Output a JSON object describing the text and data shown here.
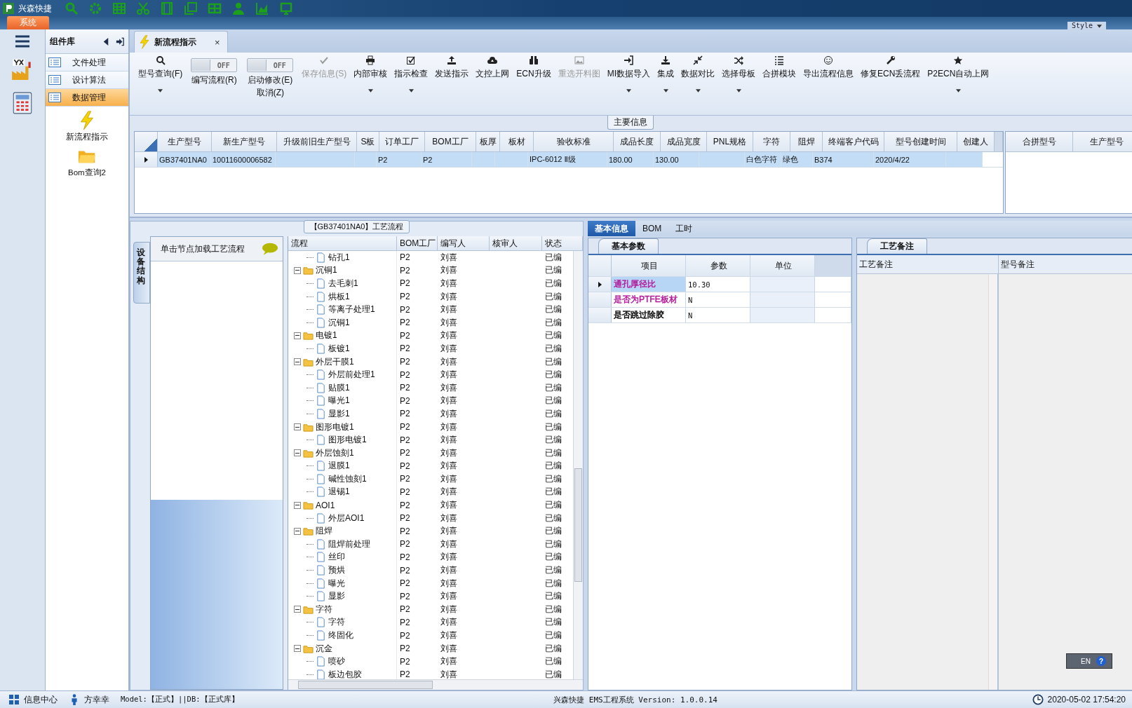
{
  "title_bar": {
    "app_name": "兴森快捷",
    "style_label": "Style"
  },
  "ribbon_tab": {
    "label": "系统"
  },
  "sidebar": {
    "title": "组件库",
    "items": [
      {
        "label": "文件处理",
        "selected": false
      },
      {
        "label": "设计算法",
        "selected": false
      },
      {
        "label": "数据管理",
        "selected": true
      }
    ],
    "tools": [
      {
        "label": "新流程指示",
        "kind": "bolt"
      },
      {
        "label": "Bom查询2",
        "kind": "folder"
      }
    ]
  },
  "document_tab": {
    "label": "新流程指示",
    "close": "×",
    "selected": true
  },
  "toolbar": [
    {
      "kind": "button",
      "label": "型号查询(F)",
      "dropdown": true,
      "disabled": false
    },
    {
      "kind": "toggle",
      "label": "编写流程(R)",
      "switch_text": "OFF",
      "on": false
    },
    {
      "kind": "toggle",
      "label": "启动修改(E)",
      "sublabel": "取消(Z)",
      "switch_text": "OFF",
      "on": false
    },
    {
      "kind": "button",
      "label": "保存信息(S)",
      "dropdown": false,
      "disabled": true
    },
    {
      "kind": "button",
      "label": "内部审核",
      "dropdown": true,
      "disabled": false
    },
    {
      "kind": "button",
      "label": "指示检查",
      "dropdown": true,
      "disabled": false
    },
    {
      "kind": "button",
      "label": "发送指示",
      "dropdown": false,
      "disabled": false
    },
    {
      "kind": "button",
      "label": "文控上网",
      "dropdown": false,
      "disabled": false
    },
    {
      "kind": "button",
      "label": "ECN升级",
      "dropdown": false,
      "disabled": false
    },
    {
      "kind": "button",
      "label": "重选开料图",
      "dropdown": false,
      "disabled": true
    },
    {
      "kind": "button",
      "label": "MI数据导入",
      "dropdown": true,
      "disabled": false
    },
    {
      "kind": "button",
      "label": "集成",
      "dropdown": true,
      "disabled": false
    },
    {
      "kind": "button",
      "label": "数据对比",
      "dropdown": true,
      "disabled": false
    },
    {
      "kind": "button",
      "label": "选择母板",
      "dropdown": true,
      "disabled": false
    },
    {
      "kind": "button",
      "label": "合拼模块",
      "dropdown": false,
      "disabled": false
    },
    {
      "kind": "button",
      "label": "导出流程信息",
      "dropdown": false,
      "disabled": false
    },
    {
      "kind": "button",
      "label": "修复ECN丢流程",
      "dropdown": false,
      "disabled": false
    },
    {
      "kind": "button",
      "label": "P2ECN自动上网",
      "dropdown": true,
      "disabled": false
    }
  ],
  "main_info": {
    "title": "主要信息",
    "columns": [
      "生产型号",
      "新生产型号",
      "升级前旧生产型号",
      "S板",
      "订单工厂",
      "BOM工厂",
      "板厚",
      "板材",
      "验收标准",
      "成品长度",
      "成品宽度",
      "PNL规格",
      "字符",
      "阻焊",
      "终端客户代码",
      "型号创建时间",
      "创建人"
    ],
    "rows": [
      {
        "selected": true,
        "cells": [
          "GB37401NA0",
          "10011600006582",
          null,
          null,
          "P2",
          "P2",
          null,
          null,
          "IPC-6012 Ⅱ级",
          "180.00",
          "130.00",
          null,
          "白色字符",
          "绿色",
          "B374",
          "2020/4/22",
          null
        ]
      }
    ],
    "merge_columns": [
      "合拼型号",
      "生产型号"
    ]
  },
  "flow_panel": {
    "title": "【GB37401NA0】工艺流程",
    "side_tab": "设备结构",
    "hint": "单击节点加载工艺流程",
    "columns": [
      "流程",
      "BOM工厂",
      "编写人",
      "核审人",
      "状态"
    ],
    "nodes": [
      {
        "children": [
          {
            "kind": "file",
            "label": "钻孔1",
            "factory": "P2",
            "writer": "刘喜",
            "status": "已编"
          }
        ]
      },
      {
        "kind": "folder",
        "label": "沉铜1",
        "expanded": true,
        "factory": "P2",
        "writer": "刘喜",
        "status": "已编",
        "children": [
          {
            "kind": "file",
            "label": "去毛刺1",
            "factory": "P2",
            "writer": "刘喜",
            "status": "已编"
          },
          {
            "kind": "file",
            "label": "烘板1",
            "factory": "P2",
            "writer": "刘喜",
            "status": "已编"
          },
          {
            "kind": "file",
            "label": "等离子处理1",
            "factory": "P2",
            "writer": "刘喜",
            "status": "已编"
          },
          {
            "kind": "file",
            "label": "沉铜1",
            "factory": "P2",
            "writer": "刘喜",
            "status": "已编"
          }
        ]
      },
      {
        "kind": "folder",
        "label": "电镀1",
        "expanded": true,
        "factory": "P2",
        "writer": "刘喜",
        "status": "已编",
        "children": [
          {
            "kind": "file",
            "label": "板镀1",
            "factory": "P2",
            "writer": "刘喜",
            "status": "已编"
          }
        ]
      },
      {
        "kind": "folder",
        "label": "外层干膜1",
        "expanded": true,
        "factory": "P2",
        "writer": "刘喜",
        "status": "已编",
        "children": [
          {
            "kind": "file",
            "label": "外层前处理1",
            "factory": "P2",
            "writer": "刘喜",
            "status": "已编"
          },
          {
            "kind": "file",
            "label": "贴膜1",
            "factory": "P2",
            "writer": "刘喜",
            "status": "已编"
          },
          {
            "kind": "file",
            "label": "曝光1",
            "factory": "P2",
            "writer": "刘喜",
            "status": "已编"
          },
          {
            "kind": "file",
            "label": "显影1",
            "factory": "P2",
            "writer": "刘喜",
            "status": "已编"
          }
        ]
      },
      {
        "kind": "folder",
        "label": "图形电镀1",
        "expanded": true,
        "factory": "P2",
        "writer": "刘喜",
        "status": "已编",
        "children": [
          {
            "kind": "file",
            "label": "图形电镀1",
            "factory": "P2",
            "writer": "刘喜",
            "status": "已编"
          }
        ]
      },
      {
        "kind": "folder",
        "label": "外层蚀刻1",
        "expanded": true,
        "factory": "P2",
        "writer": "刘喜",
        "status": "已编",
        "children": [
          {
            "kind": "file",
            "label": "退膜1",
            "factory": "P2",
            "writer": "刘喜",
            "status": "已编"
          },
          {
            "kind": "file",
            "label": "碱性蚀刻1",
            "factory": "P2",
            "writer": "刘喜",
            "status": "已编"
          },
          {
            "kind": "file",
            "label": "退锡1",
            "factory": "P2",
            "writer": "刘喜",
            "status": "已编"
          }
        ]
      },
      {
        "kind": "folder",
        "label": "AOI1",
        "expanded": true,
        "factory": "P2",
        "writer": "刘喜",
        "status": "已编",
        "children": [
          {
            "kind": "file",
            "label": "外层AOI1",
            "factory": "P2",
            "writer": "刘喜",
            "status": "已编"
          }
        ]
      },
      {
        "kind": "folder",
        "label": "阻焊",
        "expanded": true,
        "factory": "P2",
        "writer": "刘喜",
        "status": "已编",
        "children": [
          {
            "kind": "file",
            "label": "阻焊前处理",
            "factory": "P2",
            "writer": "刘喜",
            "status": "已编"
          },
          {
            "kind": "file",
            "label": "丝印",
            "factory": "P2",
            "writer": "刘喜",
            "status": "已编"
          },
          {
            "kind": "file",
            "label": "预烘",
            "factory": "P2",
            "writer": "刘喜",
            "status": "已编"
          },
          {
            "kind": "file",
            "label": "曝光",
            "factory": "P2",
            "writer": "刘喜",
            "status": "已编"
          },
          {
            "kind": "file",
            "label": "显影",
            "factory": "P2",
            "writer": "刘喜",
            "status": "已编"
          }
        ]
      },
      {
        "kind": "folder",
        "label": "字符",
        "expanded": true,
        "factory": "P2",
        "writer": "刘喜",
        "status": "已编",
        "children": [
          {
            "kind": "file",
            "label": "字符",
            "factory": "P2",
            "writer": "刘喜",
            "status": "已编"
          },
          {
            "kind": "file",
            "label": "终固化",
            "factory": "P2",
            "writer": "刘喜",
            "status": "已编"
          }
        ]
      },
      {
        "kind": "folder",
        "label": "沉金",
        "expanded": true,
        "factory": "P2",
        "writer": "刘喜",
        "status": "已编",
        "children": [
          {
            "kind": "file",
            "label": "喷砂",
            "factory": "P2",
            "writer": "刘喜",
            "status": "已编"
          },
          {
            "kind": "file",
            "label": "板边包胶",
            "factory": "P2",
            "writer": "刘喜",
            "status": "已编"
          }
        ]
      }
    ]
  },
  "detail_tabs": [
    {
      "label": "基本信息",
      "selected": true
    },
    {
      "label": "BOM",
      "selected": false
    },
    {
      "label": "工时",
      "selected": false
    }
  ],
  "params": {
    "title": "基本参数",
    "columns": [
      "项目",
      "参数",
      "单位"
    ],
    "rows": [
      {
        "item": "通孔厚径比",
        "value": "10.30",
        "selected": true,
        "color": "#b5179a"
      },
      {
        "item": "是否为PTFE板材",
        "value": "N",
        "selected": false,
        "color": "#b5179a"
      },
      {
        "item": "是否跳过除胶",
        "value": "N",
        "selected": false,
        "color": "#000000"
      }
    ]
  },
  "remarks": {
    "title": "工艺备注",
    "columns": [
      "工艺备注",
      "型号备注"
    ]
  },
  "input_indicator": {
    "language": "EN",
    "help": "?"
  },
  "status_bar": {
    "info": "信息中心",
    "user": "方幸幸",
    "model": "Model:【正式】||DB:【正式库】",
    "version": "兴森快捷 EMS工程系统 Version: 1.0.0.14",
    "datetime": "2020-05-02 17:54:20"
  }
}
